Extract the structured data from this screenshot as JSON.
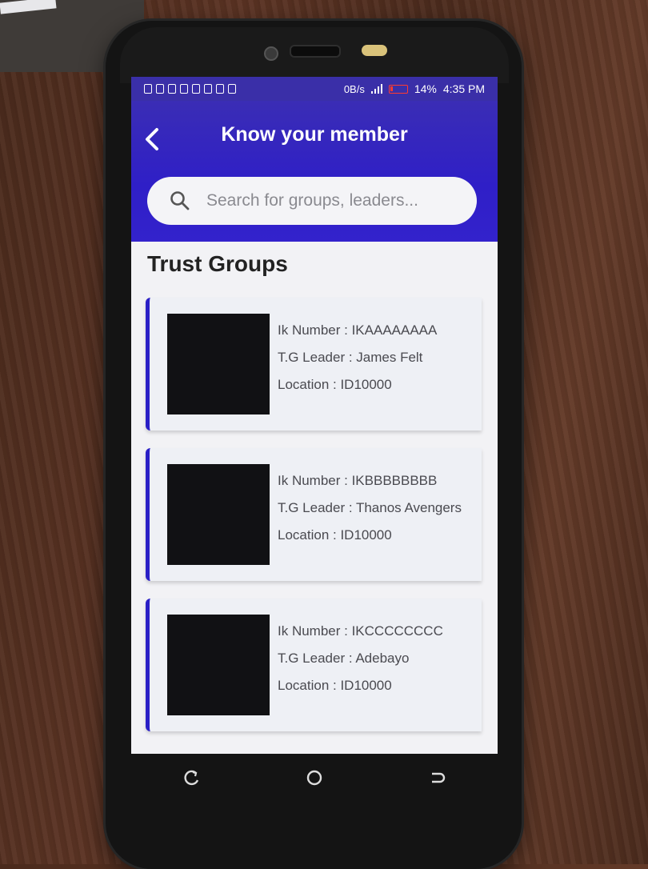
{
  "status_bar": {
    "network_speed": "0B/s",
    "battery": "14%",
    "time": "4:35 PM"
  },
  "header": {
    "title": "Know your member",
    "back_icon": "chevron-left-icon"
  },
  "search": {
    "placeholder": "Search for groups, leaders...",
    "icon": "search-icon"
  },
  "section": {
    "title": "Trust Groups"
  },
  "groups": [
    {
      "ik": "Ik Number : IKAAAAAAAA",
      "leader": "T.G Leader : James Felt",
      "location": "Location : ID10000"
    },
    {
      "ik": "Ik Number : IKBBBBBBBB",
      "leader": "T.G Leader : Thanos Avengers",
      "location": "Location : ID10000"
    },
    {
      "ik": "Ik Number : IKCCCCCCCC",
      "leader": "T.G Leader : Adebayo",
      "location": "Location : ID10000"
    }
  ],
  "colors": {
    "accent": "#2f1fc7",
    "header_bg": "#3a2db5",
    "card_bg": "#eef0f5"
  }
}
